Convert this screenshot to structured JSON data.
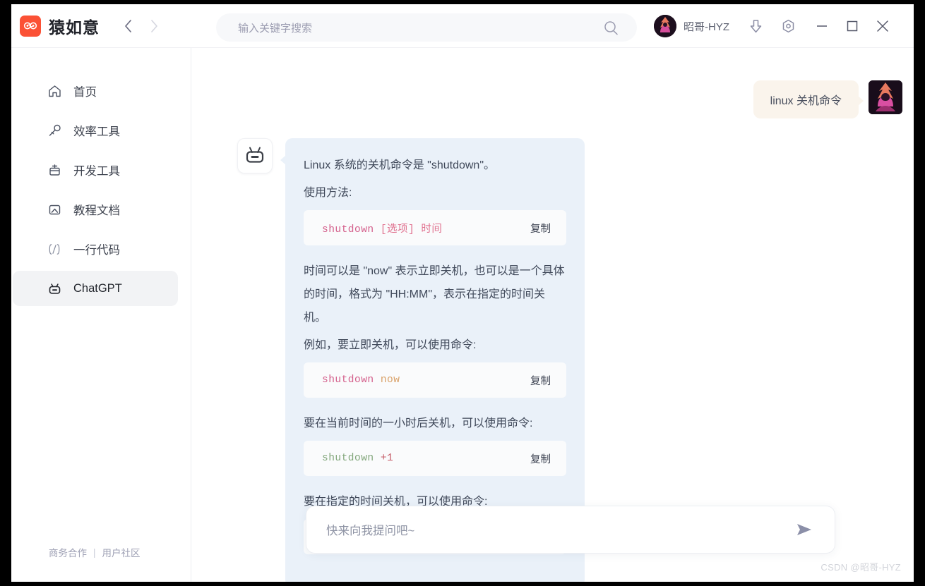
{
  "window": {
    "brand": "猿如意",
    "logo_icon": "double-spiral-logo-icon",
    "nav_back_icon": "chevron-left-icon",
    "nav_forward_icon": "chevron-right-icon",
    "accent_color": "#fb5135"
  },
  "search": {
    "placeholder": "输入关键字搜索",
    "icon": "search-icon"
  },
  "user": {
    "name": "昭哥-HYZ",
    "avatar_icon": "user-avatar"
  },
  "titlebar_icons": {
    "download": "download-arrow-icon",
    "settings": "gear-hexagon-icon",
    "minimize": "minimize-icon",
    "maximize": "maximize-icon",
    "close": "close-icon"
  },
  "sidebar": {
    "items": [
      {
        "label": "首页",
        "icon": "home-icon",
        "active": false
      },
      {
        "label": "效率工具",
        "icon": "wrench-icon",
        "active": false
      },
      {
        "label": "开发工具",
        "icon": "toolbox-icon",
        "active": false
      },
      {
        "label": "教程文档",
        "icon": "document-icon",
        "active": false
      },
      {
        "label": "一行代码",
        "icon": "code-braces-icon",
        "active": false
      },
      {
        "label": "ChatGPT",
        "icon": "robot-icon",
        "active": true
      }
    ],
    "footer": {
      "business": "商务合作",
      "separator": "|",
      "community": "用户社区"
    }
  },
  "chat": {
    "user_message": {
      "text": "linux 关机命令",
      "bubble_color": "#faf4ec"
    },
    "bot_message": {
      "avatar_icon": "robot-icon",
      "bubble_color": "#eaf1f9",
      "paragraphs": {
        "p1": "Linux 系统的关机命令是 \"shutdown\"。",
        "p2": "使用方法:",
        "p3": "时间可以是 \"now\" 表示立即关机，也可以是一个具体的时间，格式为 \"HH:MM\"，表示在指定的时间关机。",
        "p4": "例如，要立即关机，可以使用命令:",
        "p5": "要在当前时间的一小时后关机，可以使用命令:",
        "p6": "要在指定的时间关机，可以使用命令:"
      },
      "code_blocks": [
        {
          "cmd": "shutdown",
          "args": " [选项] 时间",
          "cmd_color": "#d4608c",
          "args_color": "#e0718f",
          "copy_label": "复制"
        },
        {
          "cmd": "shutdown",
          "args": " now",
          "cmd_color": "#d4608c",
          "args_color": "#d9a168",
          "copy_label": "复制"
        },
        {
          "cmd": "shutdown",
          "args": " +1",
          "cmd_color": "#83a77c",
          "args_color": "#c45a66",
          "copy_label": "复制"
        }
      ]
    }
  },
  "input": {
    "placeholder": "快来向我提问吧~",
    "value": "",
    "send_icon": "send-arrow-icon"
  },
  "watermark": {
    "text": "CSDN @昭哥-HYZ"
  }
}
